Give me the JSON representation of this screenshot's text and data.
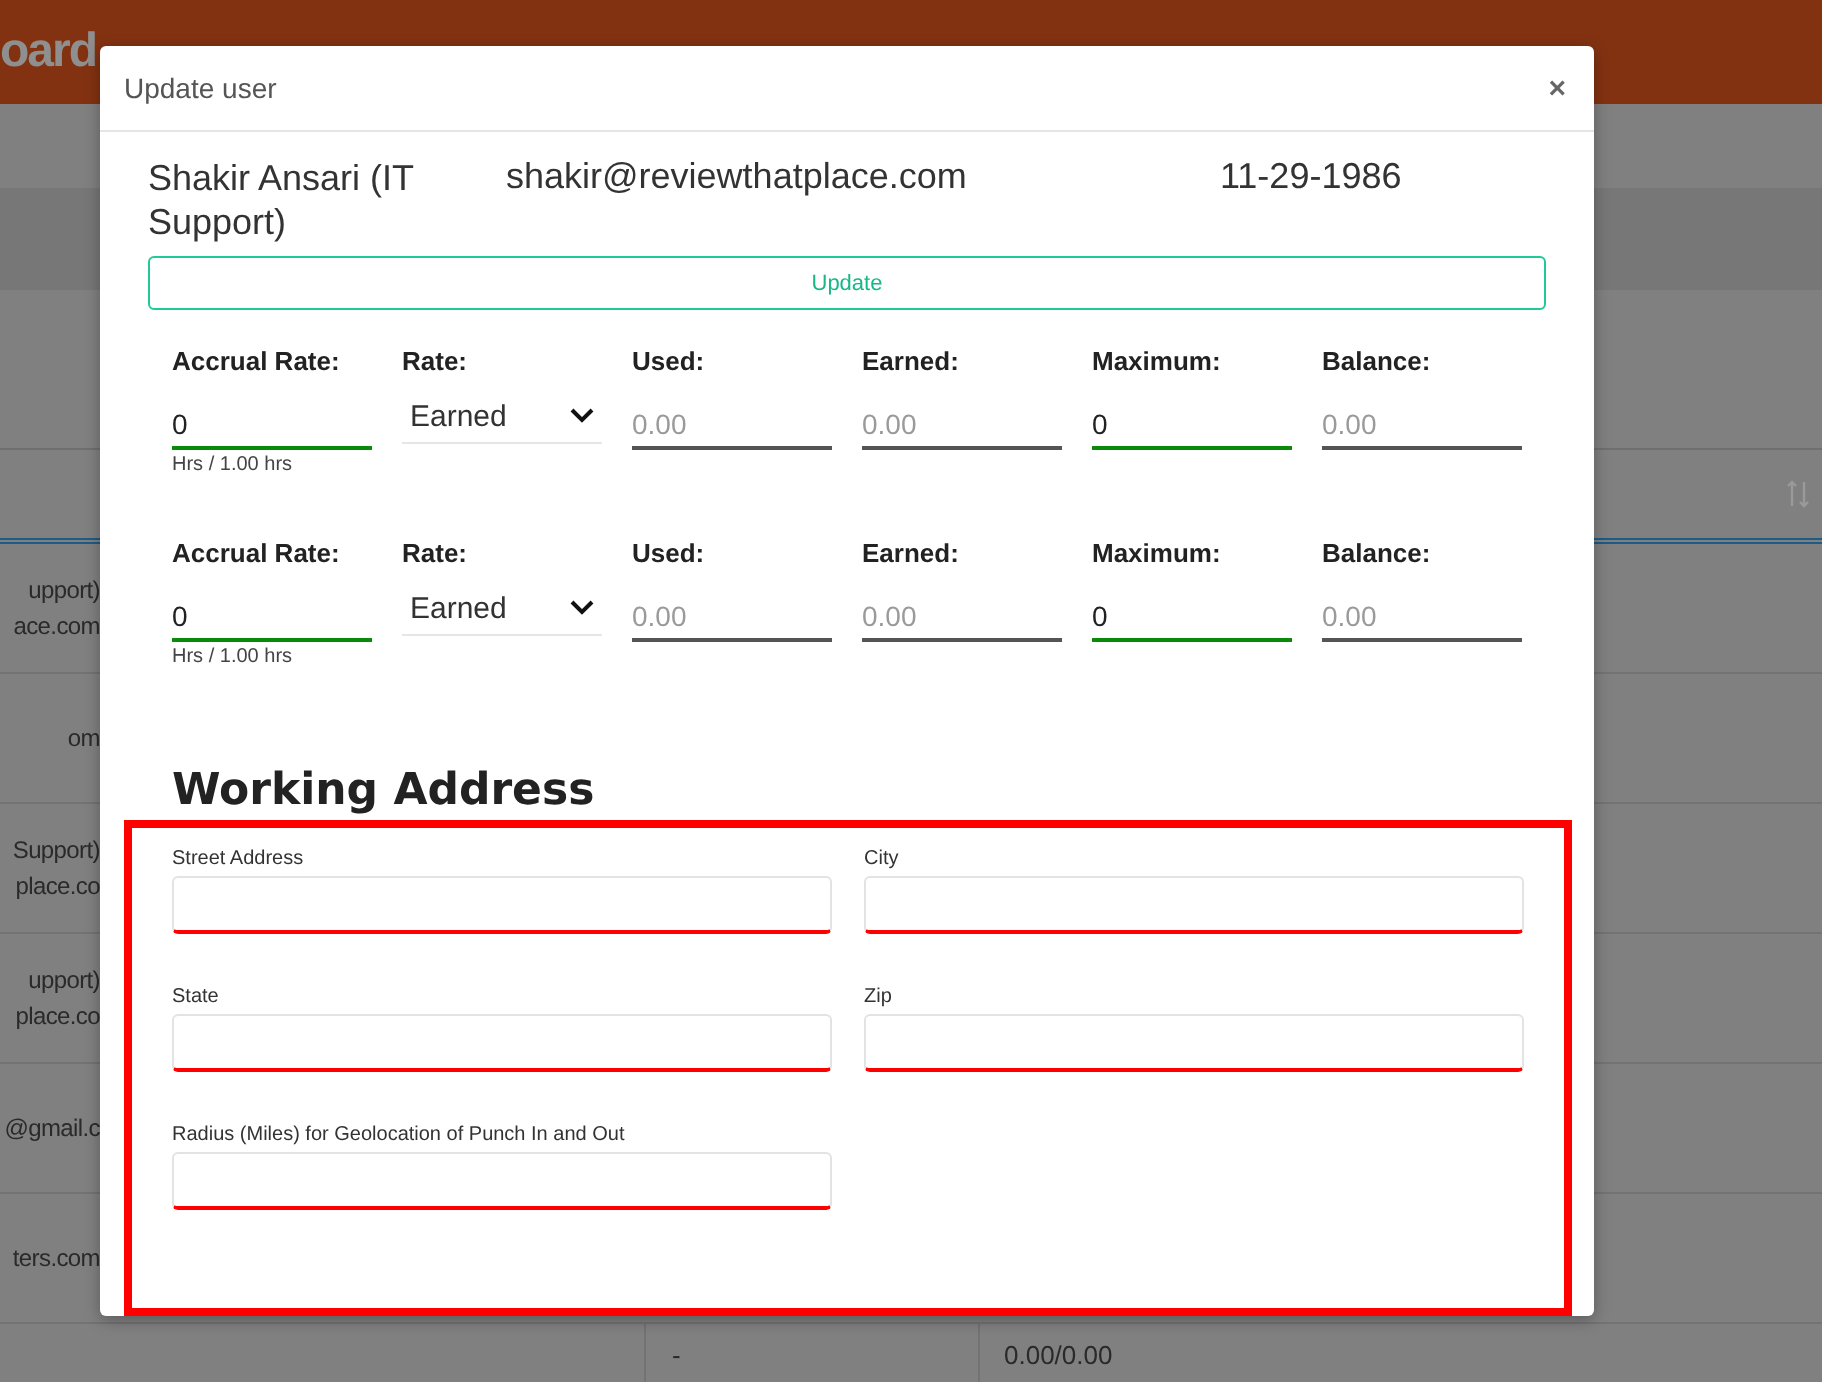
{
  "background": {
    "header_title": "oard",
    "sort_icon": true,
    "rows": [
      {
        "kind": "partial",
        "lines": [
          "upport)",
          "ace.com"
        ]
      },
      {
        "kind": "partial",
        "lines": [
          "om"
        ]
      },
      {
        "kind": "partial",
        "lines": [
          "Support)",
          "place.co"
        ]
      },
      {
        "kind": "partial",
        "lines": [
          "upport)",
          "place.co"
        ]
      },
      {
        "kind": "partial",
        "lines": [
          "@gmail.c"
        ]
      },
      {
        "kind": "partial",
        "lines": [
          "ters.com"
        ]
      },
      {
        "kind": "full",
        "cells": [
          "-",
          "0.00/0.00"
        ]
      }
    ]
  },
  "modal": {
    "title": "Update user",
    "close": "×",
    "user": {
      "name": "Shakir Ansari (IT Support)",
      "email": "shakir@reviewthatplace.com",
      "birth_date": "11-29-1986"
    },
    "update_button": "Update",
    "leave_rows": [
      {
        "fields": [
          {
            "kind": "input",
            "label": "Accrual Rate:",
            "value": "0",
            "disabled": false,
            "hint": "Hrs / 1.00 hrs"
          },
          {
            "kind": "select",
            "label": "Rate:",
            "value": "Earned"
          },
          {
            "kind": "input",
            "label": "Used:",
            "placeholder": "0.00",
            "disabled": true
          },
          {
            "kind": "input",
            "label": "Earned:",
            "placeholder": "0.00",
            "disabled": true
          },
          {
            "kind": "input",
            "label": "Maximum:",
            "value": "0",
            "disabled": false
          },
          {
            "kind": "input",
            "label": "Balance:",
            "placeholder": "0.00",
            "disabled": true
          }
        ]
      },
      {
        "fields": [
          {
            "kind": "input",
            "label": "Accrual Rate:",
            "value": "0",
            "disabled": false,
            "hint": "Hrs / 1.00 hrs"
          },
          {
            "kind": "select",
            "label": "Rate:",
            "value": "Earned"
          },
          {
            "kind": "input",
            "label": "Used:",
            "placeholder": "0.00",
            "disabled": true
          },
          {
            "kind": "input",
            "label": "Earned:",
            "placeholder": "0.00",
            "disabled": true
          },
          {
            "kind": "input",
            "label": "Maximum:",
            "value": "0",
            "disabled": false
          },
          {
            "kind": "input",
            "label": "Balance:",
            "placeholder": "0.00",
            "disabled": true
          }
        ]
      }
    ],
    "address": {
      "heading": "Working Address",
      "highlighted": true,
      "fields": [
        {
          "label": "Street Address",
          "invalid": true
        },
        {
          "label": "City",
          "invalid": true
        },
        {
          "label": "State",
          "invalid": true
        },
        {
          "label": "Zip",
          "invalid": true
        },
        {
          "label": "Radius (Miles) for Geolocation of Punch In and Out",
          "invalid": true
        }
      ]
    }
  }
}
